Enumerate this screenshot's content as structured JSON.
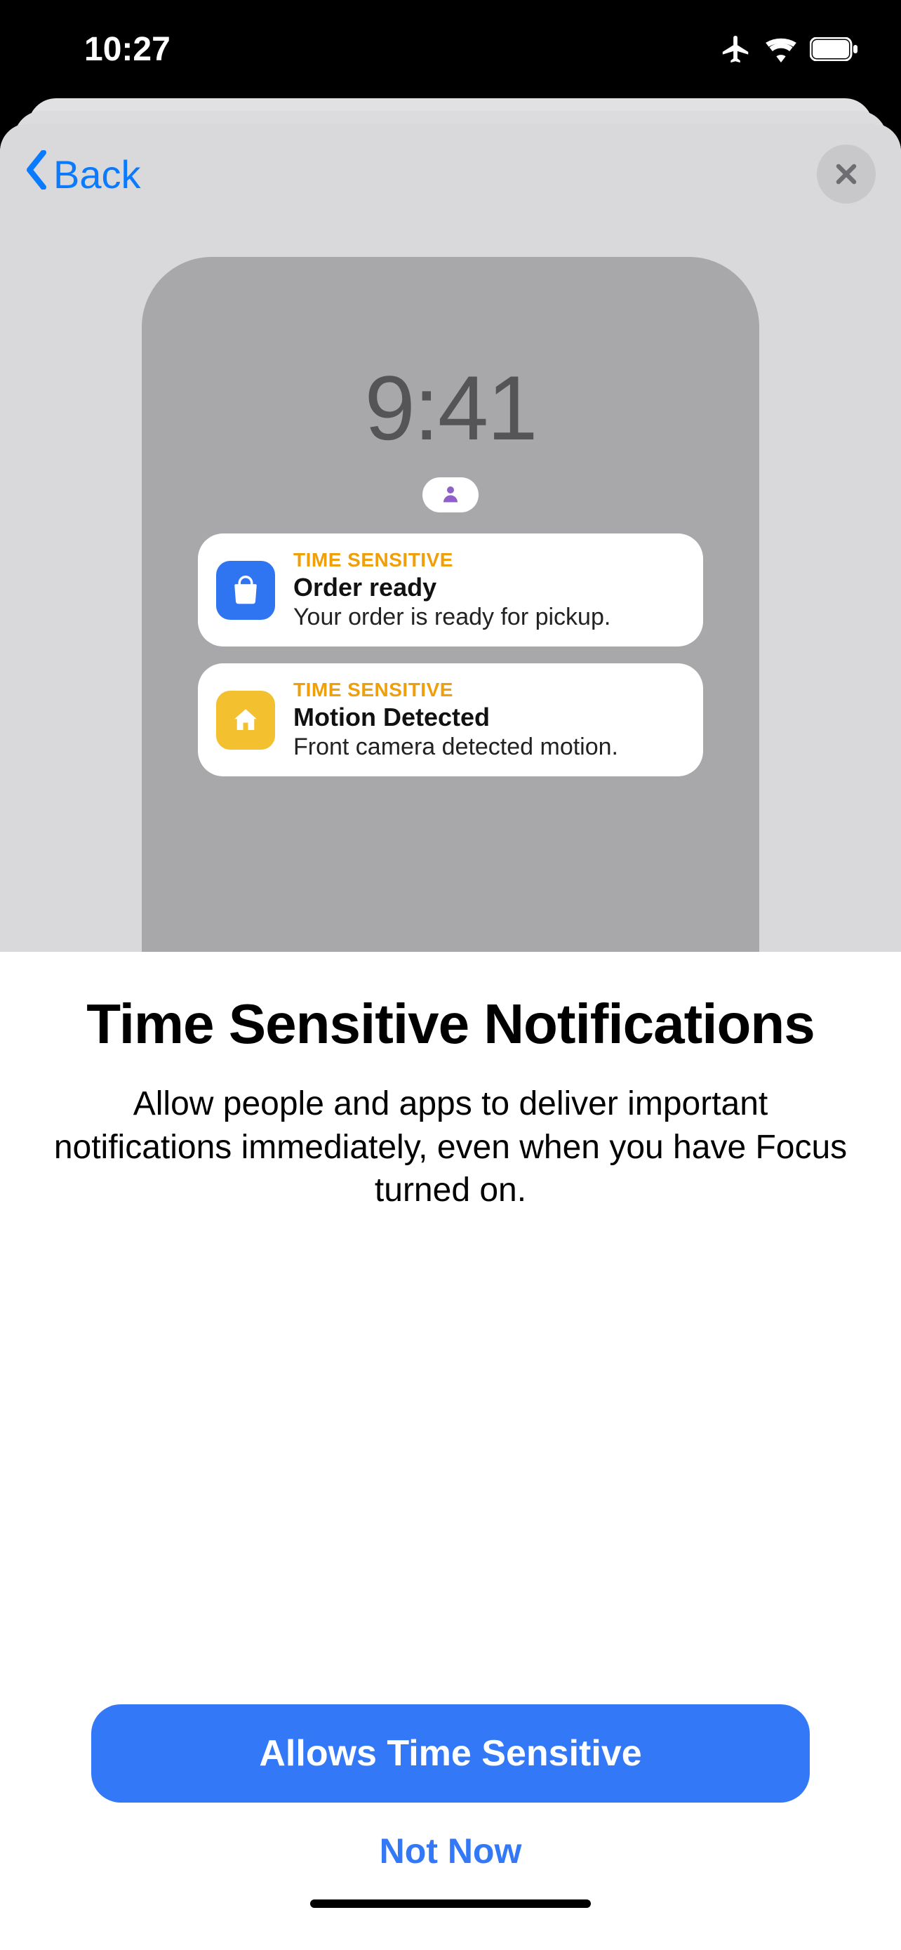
{
  "status": {
    "time": "10:27"
  },
  "nav": {
    "back_label": "Back"
  },
  "illustration": {
    "time": "9:41",
    "notifications": [
      {
        "tag": "TIME SENSITIVE",
        "title": "Order ready",
        "body": "Your order is ready for pickup.",
        "icon": "bag-icon",
        "icon_color": "blue"
      },
      {
        "tag": "TIME SENSITIVE",
        "title": "Motion Detected",
        "body": "Front camera detected motion.",
        "icon": "home-icon",
        "icon_color": "yellow"
      }
    ]
  },
  "content": {
    "headline": "Time Sensitive Notifications",
    "description": "Allow people and apps to deliver important notifications immediately, even when you have Focus turned on."
  },
  "actions": {
    "primary": "Allows Time Sensitive",
    "secondary": "Not Now"
  }
}
